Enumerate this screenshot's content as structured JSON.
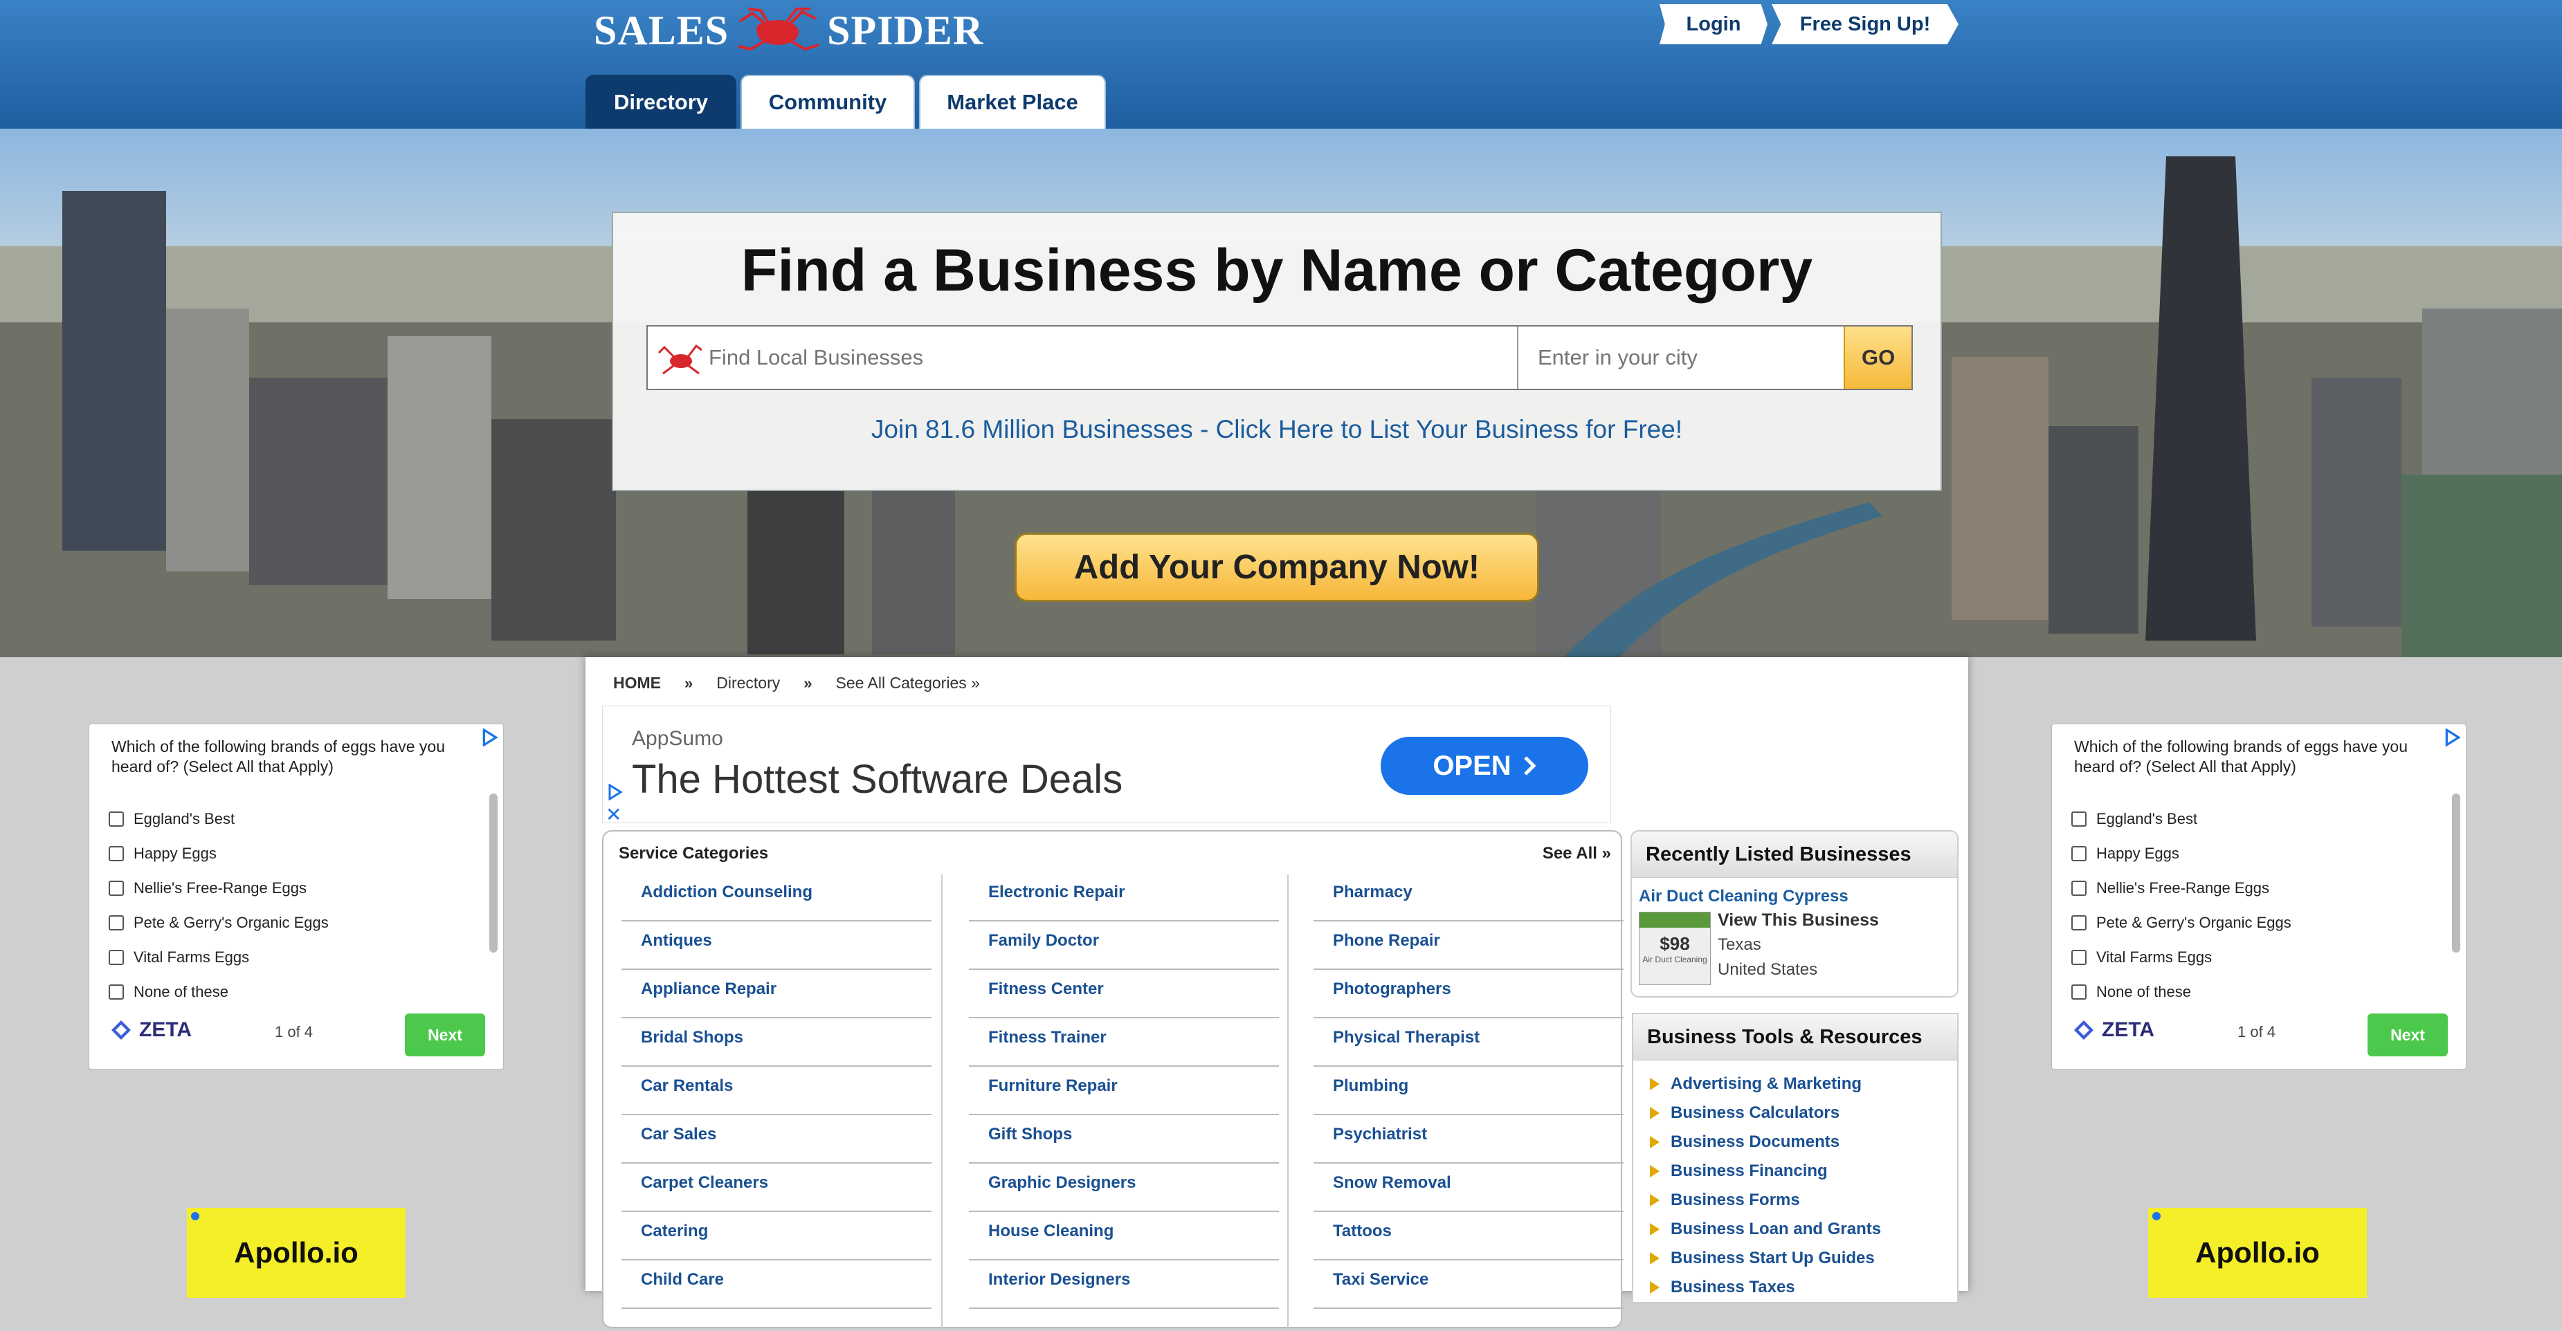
{
  "header": {
    "logo_left": "SALES",
    "logo_right": "SPIDER",
    "login": "Login",
    "signup": "Free Sign Up!",
    "tabs": [
      "Directory",
      "Community",
      "Market Place"
    ]
  },
  "hero": {
    "title": "Find a Business by Name or Category",
    "search_placeholder": "Find Local Businesses",
    "city_placeholder": "Enter in your city",
    "go": "GO",
    "join": "Join 81.6 Million Businesses - Click Here to List Your Business for Free!",
    "add_company": "Add Your Company Now!"
  },
  "breadcrumb": {
    "home": "HOME",
    "sep": "»",
    "directory": "Directory",
    "see_all": "See All Categories »"
  },
  "ad": {
    "brand": "AppSumo",
    "headline": "The Hottest Software Deals",
    "button": "OPEN",
    "close": "✕"
  },
  "service_categories": {
    "title": "Service Categories",
    "see_all": "See All »",
    "col1": [
      "Addiction Counseling",
      "Antiques",
      "Appliance Repair",
      "Bridal Shops",
      "Car Rentals",
      "Car Sales",
      "Carpet Cleaners",
      "Catering",
      "Child Care"
    ],
    "col2": [
      "Electronic Repair",
      "Family Doctor",
      "Fitness Center",
      "Fitness Trainer",
      "Furniture Repair",
      "Gift Shops",
      "Graphic Designers",
      "House Cleaning",
      "Interior Designers"
    ],
    "col3": [
      "Pharmacy",
      "Phone Repair",
      "Photographers",
      "Physical Therapist",
      "Plumbing",
      "Psychiatrist",
      "Snow Removal",
      "Tattoos",
      "Taxi Service"
    ]
  },
  "recent": {
    "title": "Recently Listed Businesses",
    "name": "Air Duct Cleaning Cypress",
    "view": "View This Business",
    "state": "Texas",
    "country": "United States",
    "thumb_price": "$98",
    "thumb_caption": "Air Duct Cleaning"
  },
  "tools": {
    "title": "Business Tools & Resources",
    "items": [
      "Advertising & Marketing",
      "Business Calculators",
      "Business Documents",
      "Business Financing",
      "Business Forms",
      "Business Loan and Grants",
      "Business Start Up Guides",
      "Business Taxes"
    ]
  },
  "side_ad": {
    "question": "Which of the following brands of eggs have you heard of? (Select All that Apply)",
    "options": [
      "Eggland's Best",
      "Happy Eggs",
      "Nellie's Free-Range Eggs",
      "Pete & Gerry's Organic Eggs",
      "Vital Farms Eggs",
      "None of these"
    ],
    "brand": "ZETA",
    "page": "1 of 4",
    "next": "Next",
    "apollo": "Apollo.io"
  }
}
